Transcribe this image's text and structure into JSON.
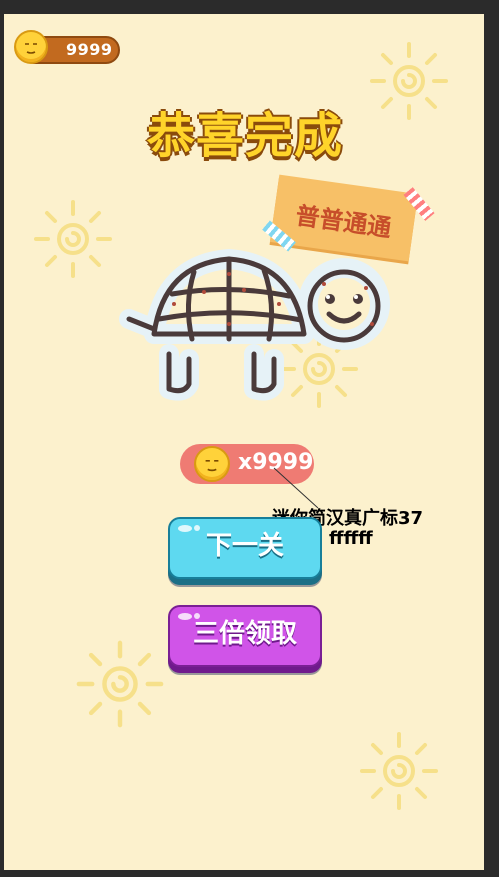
{
  "header": {
    "coin_count": "9999",
    "coin_icon": "coin-face-icon"
  },
  "title": "恭喜完成",
  "rating_badge": {
    "label": "普普通通"
  },
  "artwork": {
    "subject": "turtle"
  },
  "reward": {
    "multiplier_text": "x9999"
  },
  "annotation": {
    "line1": "迷你简汉真广标37",
    "line2": "ffffff"
  },
  "buttons": {
    "next_label": "下一关",
    "triple_label": "三倍领取"
  },
  "colors": {
    "background": "#fcf1cd",
    "title": "#ffd42a",
    "reward_pill": "#ef7b73",
    "next_button": "#5ed9f0",
    "triple_button": "#d054e8",
    "coin_pill": "#c26a1f"
  }
}
